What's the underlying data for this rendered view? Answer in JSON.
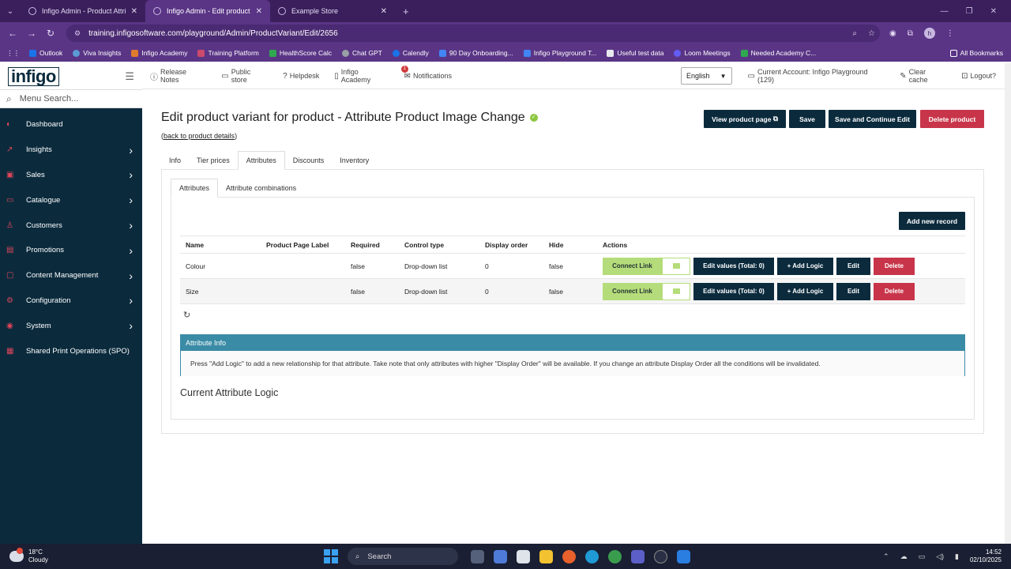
{
  "browser": {
    "tabs": [
      {
        "label": "Infigo Admin - Product Attribut",
        "active": false
      },
      {
        "label": "Infigo Admin - Edit product var",
        "active": true
      },
      {
        "label": "Example Store",
        "active": false
      }
    ],
    "url": "training.infigosoftware.com/playground/Admin/ProductVariant/Edit/2656",
    "avatar_letter": "h",
    "bookmarks": [
      {
        "label": "Outlook",
        "color": "#1a73e8"
      },
      {
        "label": "Viva Insights",
        "color": "#5b9bd5"
      },
      {
        "label": "Infigo Academy",
        "color": "#e07a2e"
      },
      {
        "label": "Training Platform",
        "color": "#cc4a6b"
      },
      {
        "label": "HealthScore Calc",
        "color": "#2fa84f"
      },
      {
        "label": "Chat GPT",
        "color": "#9aa0a6"
      },
      {
        "label": "Calendly",
        "color": "#1a73e8"
      },
      {
        "label": "90 Day Onboarding...",
        "color": "#4285f4"
      },
      {
        "label": "Infigo Playground T...",
        "color": "#4285f4"
      },
      {
        "label": "Useful test data",
        "color": "#e8eaed"
      },
      {
        "label": "Loom Meetings",
        "color": "#625df5"
      },
      {
        "label": "Needed Academy C...",
        "color": "#2fa84f"
      }
    ],
    "all_bookmarks": "All Bookmarks"
  },
  "sidebar": {
    "logo": "infigo",
    "search_placeholder": "Menu Search...",
    "items": [
      {
        "label": "Dashboard",
        "icon": "dashboard-icon",
        "glyph": "◐",
        "chevron": false
      },
      {
        "label": "Insights",
        "icon": "insights-icon",
        "glyph": "↗",
        "chevron": true
      },
      {
        "label": "Sales",
        "icon": "sales-icon",
        "glyph": "▣",
        "chevron": true
      },
      {
        "label": "Catalogue",
        "icon": "catalogue-icon",
        "glyph": "▭",
        "chevron": true
      },
      {
        "label": "Customers",
        "icon": "customers-icon",
        "glyph": "♙",
        "chevron": true
      },
      {
        "label": "Promotions",
        "icon": "promotions-icon",
        "glyph": "▤",
        "chevron": true
      },
      {
        "label": "Content Management",
        "icon": "content-icon",
        "glyph": "▢",
        "chevron": true
      },
      {
        "label": "Configuration",
        "icon": "configuration-icon",
        "glyph": "⚙",
        "chevron": true
      },
      {
        "label": "System",
        "icon": "system-icon",
        "glyph": "◉",
        "chevron": true
      },
      {
        "label": "Shared Print Operations (SPO)",
        "icon": "spo-icon",
        "glyph": "▦",
        "chevron": false
      }
    ]
  },
  "topnav": {
    "release_notes": "Release Notes",
    "public_store": "Public store",
    "helpdesk": "Helpdesk",
    "infigo_academy": "Infigo Academy",
    "notifications": "Notifications",
    "notifications_count": "1",
    "language": "English",
    "current_account": "Current Account: Infigo Playground (129)",
    "clear_cache": "Clear cache",
    "logout": "Logout?"
  },
  "page": {
    "title": "Edit product variant for product - Attribute Product Image Change",
    "back_link": "back to product details",
    "buttons": {
      "view_product_page": "View product page",
      "save": "Save",
      "save_continue": "Save and Continue Edit",
      "delete_product": "Delete product"
    },
    "main_tabs": [
      "Info",
      "Tier prices",
      "Attributes",
      "Discounts",
      "Inventory"
    ],
    "sub_tabs": [
      "Attributes",
      "Attribute combinations"
    ],
    "add_new_record": "Add new record",
    "grid": {
      "headers": [
        "Name",
        "Product Page Label",
        "Required",
        "Control type",
        "Display order",
        "Hide",
        "Actions"
      ],
      "rows": [
        {
          "name": "Colour",
          "label": "",
          "required": "false",
          "control_type": "Drop-down list",
          "display_order": "0",
          "hide": "false"
        },
        {
          "name": "Size",
          "label": "",
          "required": "false",
          "control_type": "Drop-down list",
          "display_order": "0",
          "hide": "false"
        }
      ],
      "actions": {
        "connect_link": "Connect Link",
        "edit_values": "Edit values (Total: 0)",
        "add_logic": "+ Add Logic",
        "edit": "Edit",
        "delete": "Delete"
      }
    },
    "info_box": {
      "title": "Attribute Info",
      "text": "Press \"Add Logic\" to add a new relationship for that attribute. Take note that only attributes with higher \"Display Order\" will be available. If you change an attribute Display Order all the conditions will be invalidated."
    },
    "logic_title": "Current Attribute Logic"
  },
  "taskbar": {
    "temperature": "18°C",
    "weather": "Cloudy",
    "search": "Search",
    "time": "14:52",
    "date": "02/10/2025"
  }
}
